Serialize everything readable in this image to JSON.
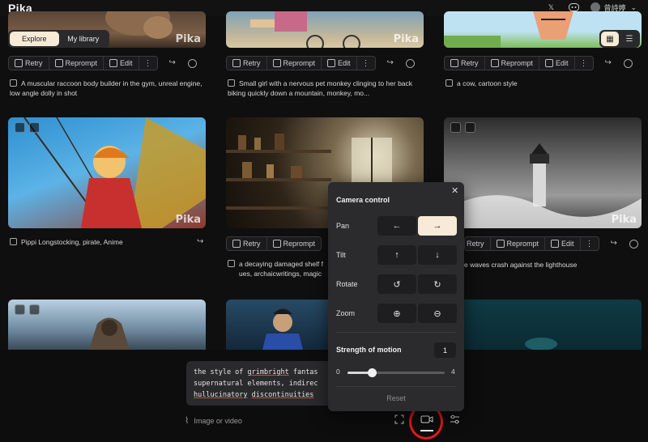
{
  "app": {
    "title": "Pika"
  },
  "header": {
    "user_name": "曾詩婷",
    "chevron": "⌄"
  },
  "tabs": {
    "explore": "Explore",
    "library": "My library"
  },
  "actions": {
    "retry": "Retry",
    "reprompt": "Reprompt",
    "edit": "Edit",
    "more": "⋮"
  },
  "watermark": "Pika",
  "cards": [
    {
      "caption": "A muscular raccoon body builder in the gym, unreal engine, low angle dolly in shot"
    },
    {
      "caption": "Small girl with a nervous pet monkey clinging to her back biking quickly down a mountain, monkey, mo..."
    },
    {
      "caption": "a cow, cartoon style"
    },
    {
      "caption": "Pippi Longstocking, pirate, Anime"
    },
    {
      "caption": "a decaying damaged shelf f",
      "caption2": "ues, archaicwritings, magic"
    },
    {
      "caption": "e waves crash against the lighthouse"
    }
  ],
  "prompt": {
    "line1_a": "the style of ",
    "line1_b": "grimbright",
    "line1_c": " fantas",
    "line2_a": "supernatural elements, ",
    "line2_b": "indirec",
    "line3_a": "hullucinatory",
    "line3_b": " ",
    "line3_c": "discontinuities"
  },
  "attach": {
    "label": "Image or video"
  },
  "camera_panel": {
    "title": "Camera control",
    "close": "✕",
    "pan_label": "Pan",
    "tilt_label": "Tilt",
    "rotate_label": "Rotate",
    "zoom_label": "Zoom",
    "pan_left": "←",
    "pan_right": "→",
    "tilt_up": "↑",
    "tilt_down": "↓",
    "rotate_ccw": "↺",
    "rotate_cw": "↻",
    "zoom_in": "⊕",
    "zoom_out": "⊖",
    "pan_selected": "right",
    "strength_label": "Strength of motion",
    "strength_value": "1",
    "slider_min": "0",
    "slider_max": "4",
    "slider_min_value": 0,
    "slider_max_value": 4,
    "slider_current": 1,
    "reset_label": "Reset"
  },
  "colors": {
    "accent": "#f7ead6",
    "annotation": "#e01919",
    "background": "#0f0f10"
  }
}
